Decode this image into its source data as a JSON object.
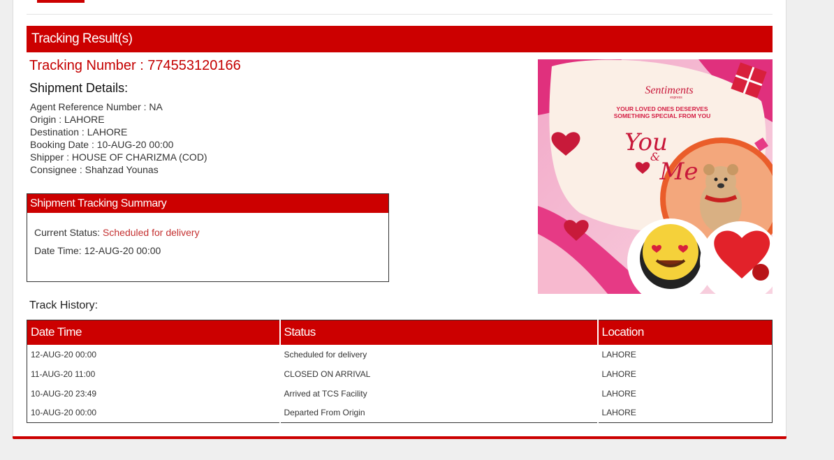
{
  "results": {
    "title": "Tracking Result(s)",
    "tracking_number": "Tracking Number : 774553120166",
    "details_title": "Shipment Details:",
    "details": [
      "Agent Reference Number : NA",
      "Origin : LAHORE",
      "Destination : LAHORE",
      "Booking Date : 10-AUG-20 00:00",
      "Shipper : HOUSE OF CHARIZMA (COD)",
      "Consignee : Shahzad Younas"
    ]
  },
  "summary": {
    "title": "Shipment Tracking Summary",
    "status_label": "Current Status: ",
    "status_value": "Scheduled for delivery",
    "datetime": "Date Time: 12-AUG-20 00:00"
  },
  "promo": {
    "brand": "Sentiments",
    "brand_sub": "express",
    "line1": "YOUR LOVED ONES DESERVES",
    "line2": "SOMETHING SPECIAL FROM YOU",
    "script1": "You",
    "script2": "&",
    "script3": "Me"
  },
  "history": {
    "title": "Track History:",
    "columns": [
      "Date Time",
      "Status",
      "Location"
    ],
    "rows": [
      [
        "12-AUG-20 00:00",
        "Scheduled for delivery",
        "LAHORE"
      ],
      [
        "11-AUG-20 11:00",
        "CLOSED ON ARRIVAL",
        "LAHORE"
      ],
      [
        "10-AUG-20 23:49",
        "Arrived at TCS Facility",
        "LAHORE"
      ],
      [
        "10-AUG-20 00:00",
        "Departed From Origin",
        "LAHORE"
      ]
    ]
  },
  "colors": {
    "accent": "#cc0000",
    "status": "#c43030"
  }
}
